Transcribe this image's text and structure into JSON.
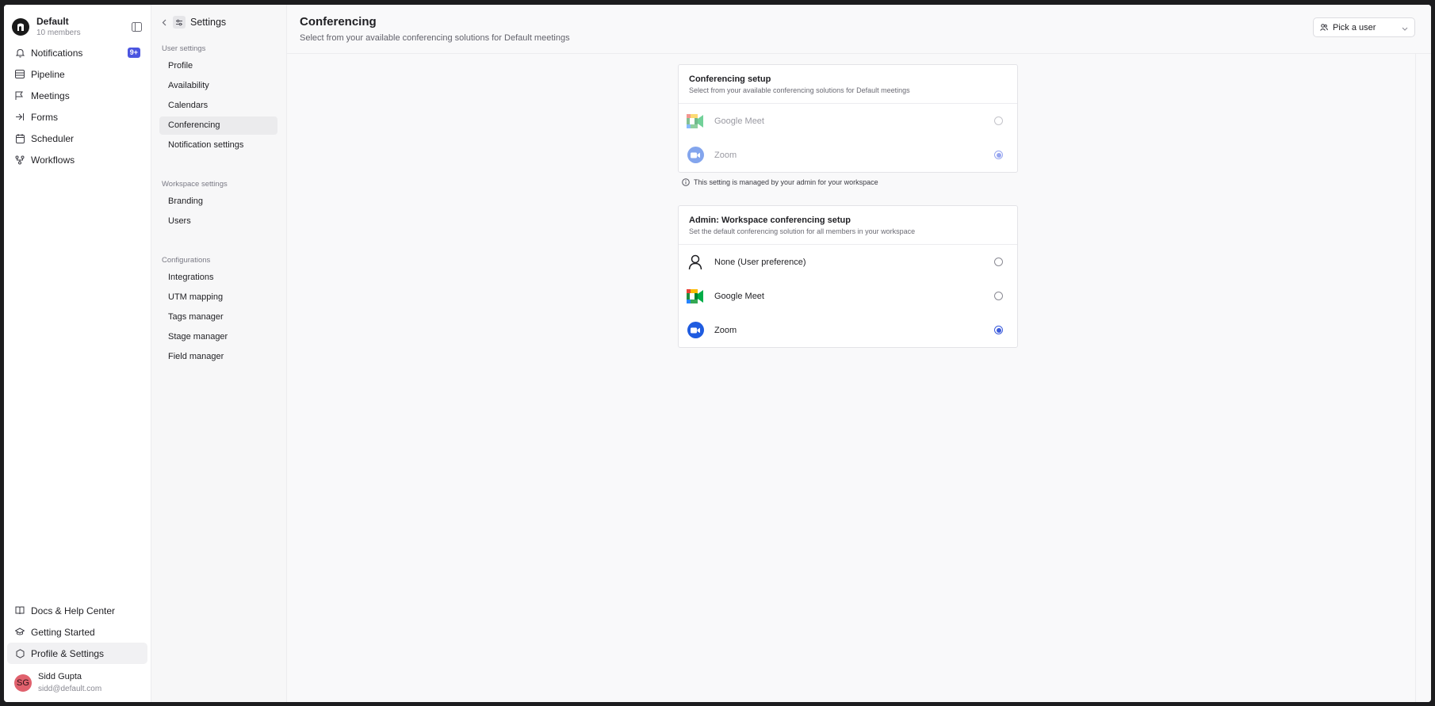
{
  "workspace": {
    "name": "Default",
    "members": "10 members"
  },
  "nav": {
    "items": [
      {
        "label": "Notifications",
        "icon": "bell-icon",
        "badge": "9+"
      },
      {
        "label": "Pipeline",
        "icon": "pipeline-icon"
      },
      {
        "label": "Meetings",
        "icon": "meetings-icon"
      },
      {
        "label": "Forms",
        "icon": "forms-icon"
      },
      {
        "label": "Scheduler",
        "icon": "calendar-icon"
      },
      {
        "label": "Workflows",
        "icon": "workflow-icon"
      }
    ],
    "bottom": [
      {
        "label": "Docs & Help Center",
        "icon": "book-icon"
      },
      {
        "label": "Getting Started",
        "icon": "graduation-icon"
      },
      {
        "label": "Profile & Settings",
        "icon": "hexagon-icon"
      }
    ]
  },
  "user": {
    "initials": "SG",
    "name": "Sidd Gupta",
    "email": "sidd@default.com"
  },
  "settings": {
    "title": "Settings",
    "groups": [
      {
        "label": "User settings",
        "items": [
          "Profile",
          "Availability",
          "Calendars",
          "Conferencing",
          "Notification settings"
        ]
      },
      {
        "label": "Workspace settings",
        "items": [
          "Branding",
          "Users"
        ]
      },
      {
        "label": "Configurations",
        "items": [
          "Integrations",
          "UTM mapping",
          "Tags manager",
          "Stage manager",
          "Field manager"
        ]
      }
    ],
    "active": "Conferencing"
  },
  "main": {
    "title": "Conferencing",
    "subtitle": "Select from your available conferencing solutions for Default meetings",
    "pick_user": "Pick a user"
  },
  "user_card": {
    "title": "Conferencing setup",
    "subtitle": "Select from your available conferencing solutions for Default meetings",
    "options": [
      {
        "name": "Google Meet",
        "selected": false
      },
      {
        "name": "Zoom",
        "selected": true
      }
    ],
    "note": "This setting is managed by your admin for your workspace"
  },
  "admin_card": {
    "title": "Admin: Workspace conferencing setup",
    "subtitle": "Set the default conferencing solution for all members in your workspace",
    "options": [
      {
        "name": "None (User preference)",
        "selected": false
      },
      {
        "name": "Google Meet",
        "selected": false
      },
      {
        "name": "Zoom",
        "selected": true
      }
    ]
  },
  "colors": {
    "accent": "#3b5bdb",
    "badge": "#4b55e0",
    "zoom": "#1f5ce0"
  }
}
